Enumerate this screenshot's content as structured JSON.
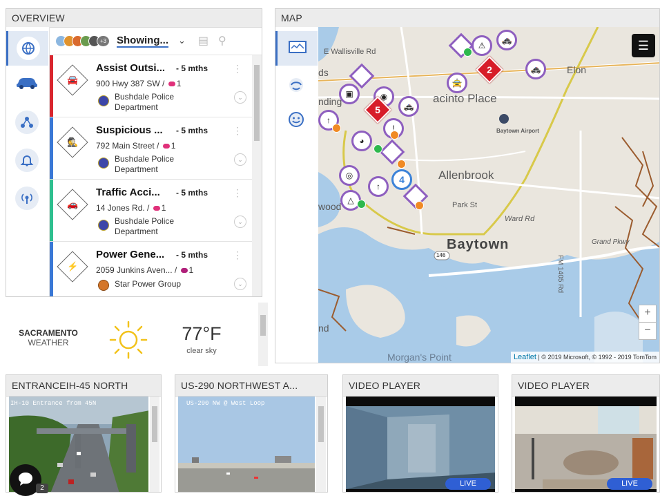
{
  "overview": {
    "title": "OVERVIEW",
    "nav": [
      "globe-icon",
      "car-icon",
      "network-icon",
      "bell-icon",
      "sensor-icon"
    ],
    "filter": {
      "showing_label": "Showing...",
      "extra_count": "+3"
    },
    "items": [
      {
        "title": "Assist Outsi...",
        "age": "- 5 mths",
        "address": "900 Hwy 387 SW /",
        "count": "1",
        "department": "Bushdale Police Department",
        "stripe": "#d9262e",
        "icon": "assist-icon"
      },
      {
        "title": "Suspicious ...",
        "age": "- 5 mths",
        "address": "792 Main Street /",
        "count": "1",
        "department": "Bushdale Police Department",
        "stripe": "#3a78d6",
        "icon": "suspicious-icon"
      },
      {
        "title": "Traffic Acci...",
        "age": "- 5 mths",
        "address": "14 Jones Rd. /",
        "count": "1",
        "department": "Bushdale Police Department",
        "stripe": "#2ebf8f",
        "icon": "traffic-accident-icon"
      },
      {
        "title": "Power Gene...",
        "age": "- 5 mths",
        "address": "2059 Junkins Aven... /",
        "count": "1",
        "department": "Star Power Group",
        "stripe": "#3a78d6",
        "icon": "power-icon"
      }
    ]
  },
  "weather": {
    "city": "SACRAMENTO",
    "label": "WEATHER",
    "temp": "77°F",
    "condition": "clear sky"
  },
  "map": {
    "title": "MAP",
    "labels": {
      "wallisville": "E Wallisville Rd",
      "jacinto": "acinto Place",
      "airport": "Baytown Airport",
      "allenbrook": "Allenbrook",
      "park": "Park St",
      "ward": "Ward Rd",
      "baytown": "Baytown",
      "grand": "Grand Pkwy",
      "fm": "FM 1405 Rd",
      "morgans": "Morgan's Point",
      "elon": "Elon",
      "ds": "ds",
      "nding": "nding",
      "wood": "wood",
      "nd": "nd",
      "route146": "146"
    },
    "clusters": [
      "2",
      "5",
      "4"
    ],
    "attribution": {
      "leaflet": "Leaflet",
      "text": "| © 2019 Microsoft, © 1992 - 2019 TomTom"
    }
  },
  "cameras": [
    {
      "title": "ENTRANCEIH-45 NORTH",
      "caption": "IH-10 Entrance from 45N"
    },
    {
      "title": "US-290 NORTHWEST A...",
      "caption": "US-290 NW @ West Loop"
    },
    {
      "title": "VIDEO PLAYER",
      "live": "LIVE"
    },
    {
      "title": "VIDEO PLAYER",
      "live": "LIVE"
    }
  ],
  "chat": {
    "count": "2"
  }
}
